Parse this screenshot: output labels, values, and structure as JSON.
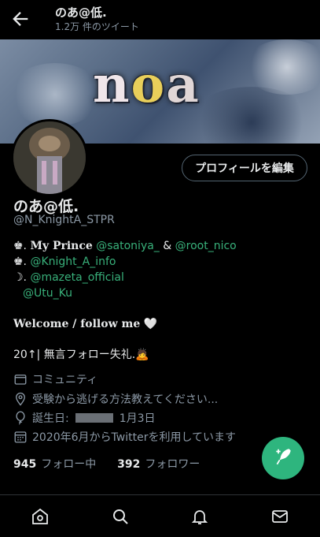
{
  "header": {
    "title": "のあ@低.",
    "tweet_count": "1.2万 件のツイート"
  },
  "banner": {
    "logo_text": [
      "n",
      "o",
      "a"
    ]
  },
  "profile": {
    "edit_label": "プロフィールを編集",
    "name": "のあ@低.",
    "handle": "@N_KnightA_STPR"
  },
  "bio": {
    "line1": {
      "prefix": "♚. ",
      "bold": "My Prince",
      "link1": "@satoniya_",
      "amp": " & ",
      "link2": "@root_nico"
    },
    "line2": {
      "prefix": "♚.  ",
      "link": "@Knight_A_info"
    },
    "line3": {
      "prefix": "☽. ",
      "link": "@mazeta_official"
    },
    "line4": {
      "link": "@Utu_Ku"
    },
    "line5": {
      "bold": "Welcome / follow me",
      "emoji": "🤍"
    },
    "line6": {
      "text": "20↑| 無言フォロー失礼.",
      "emoji": "🙇"
    }
  },
  "meta": {
    "community": "コミュニティ",
    "location": "受験から逃げる方法教えてください...",
    "birthday_label": "誕生日:",
    "birthday_date": "1月3日",
    "joined": "2020年6月からTwitterを利用しています"
  },
  "stats": {
    "following_count": "945",
    "following_label": "フォロー中",
    "followers_count": "392",
    "followers_label": "フォロワー"
  },
  "icons": {
    "back": "back-arrow-icon",
    "community": "community-icon",
    "location": "location-icon",
    "birthday": "balloon-icon",
    "calendar": "calendar-icon",
    "compose": "compose-feather-icon",
    "home": "home-icon",
    "search": "search-icon",
    "notifications": "bell-icon",
    "messages": "mail-icon"
  },
  "colors": {
    "background": "#000000",
    "accent_link": "#38b07a",
    "fab": "#2eb57e",
    "muted_text": "#8b98a5"
  }
}
